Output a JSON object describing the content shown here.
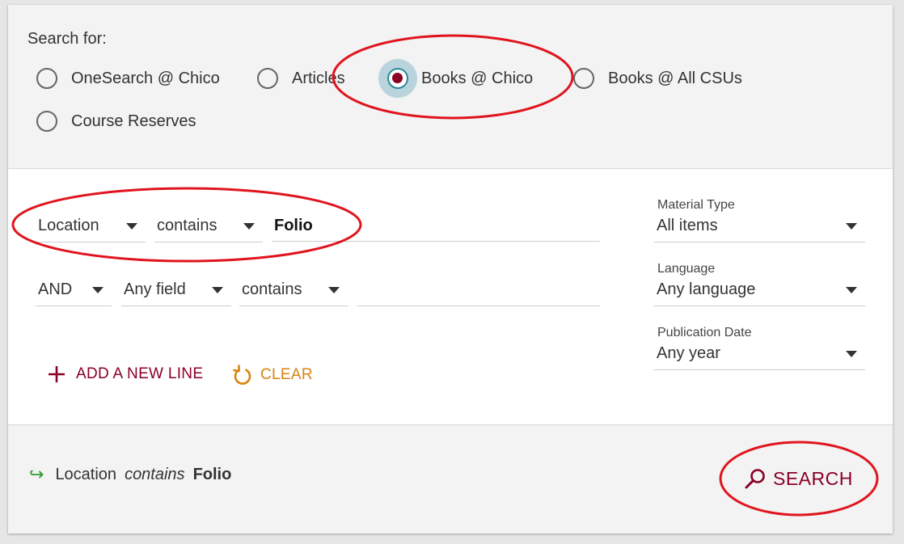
{
  "search_for": {
    "label": "Search for:",
    "options": [
      {
        "label": "OneSearch @ Chico",
        "selected": false
      },
      {
        "label": "Articles",
        "selected": false
      },
      {
        "label": "Books @ Chico",
        "selected": true
      },
      {
        "label": "Books @ All CSUs",
        "selected": false
      },
      {
        "label": "Course Reserves",
        "selected": false
      }
    ]
  },
  "query_lines": [
    {
      "field": "Location",
      "operator": "contains",
      "value": "Folio"
    },
    {
      "boolean": "AND",
      "field": "Any field",
      "operator": "contains",
      "value": ""
    }
  ],
  "filters": {
    "material_type": {
      "label": "Material Type",
      "value": "All items"
    },
    "language": {
      "label": "Language",
      "value": "Any language"
    },
    "publication_date": {
      "label": "Publication Date",
      "value": "Any year"
    }
  },
  "actions": {
    "add_line": "ADD A NEW LINE",
    "clear": "CLEAR",
    "search": "SEARCH"
  },
  "summary": {
    "field": "Location",
    "operator": "contains",
    "value": "Folio"
  },
  "colors": {
    "brand": "#8a0026",
    "clear": "#d9840f",
    "summary_arrow": "#2e9a34",
    "annotation": "#e0141e"
  }
}
